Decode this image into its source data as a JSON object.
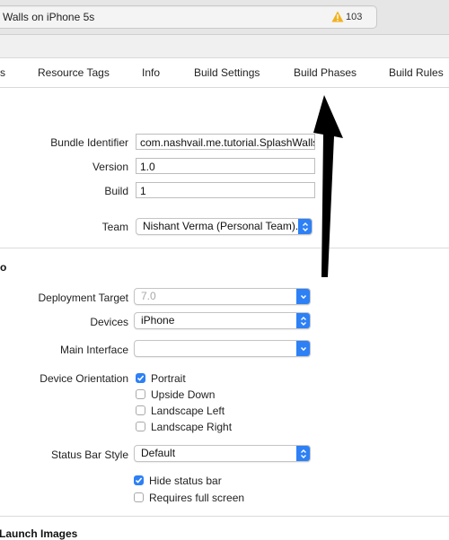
{
  "toolbar": {
    "status_text": "Walls on iPhone 5s",
    "warning_icon": "warning-triangle-icon",
    "warning_count": "103",
    "warning_color": "#f1b11f"
  },
  "tabs": [
    {
      "label": "s"
    },
    {
      "label": "Resource Tags"
    },
    {
      "label": "Info"
    },
    {
      "label": "Build Settings"
    },
    {
      "label": "Build Phases"
    },
    {
      "label": "Build Rules"
    }
  ],
  "identity": {
    "bundle_identifier_label": "Bundle Identifier",
    "bundle_identifier_value": "com.nashvail.me.tutorial.SplashWalls",
    "version_label": "Version",
    "version_value": "1.0",
    "build_label": "Build",
    "build_value": "1",
    "team_label": "Team",
    "team_value": "Nishant Verma (Personal Team)..."
  },
  "deployment": {
    "section_title": "o",
    "deployment_target_label": "Deployment Target",
    "deployment_target_value": "7.0",
    "devices_label": "Devices",
    "devices_value": "iPhone",
    "main_interface_label": "Main Interface",
    "main_interface_value": "",
    "device_orientation_label": "Device Orientation",
    "orientations": [
      {
        "label": "Portrait",
        "checked": true
      },
      {
        "label": "Upside Down",
        "checked": false
      },
      {
        "label": "Landscape Left",
        "checked": false
      },
      {
        "label": "Landscape Right",
        "checked": false
      }
    ],
    "status_bar_style_label": "Status Bar Style",
    "status_bar_style_value": "Default",
    "hide_status_bar_label": "Hide status bar",
    "hide_status_bar_checked": true,
    "requires_full_screen_label": "Requires full screen",
    "requires_full_screen_checked": false
  },
  "launch": {
    "section_title": "Launch Images"
  },
  "colors": {
    "accent": "#2d80f6",
    "arrow": "#000000"
  }
}
